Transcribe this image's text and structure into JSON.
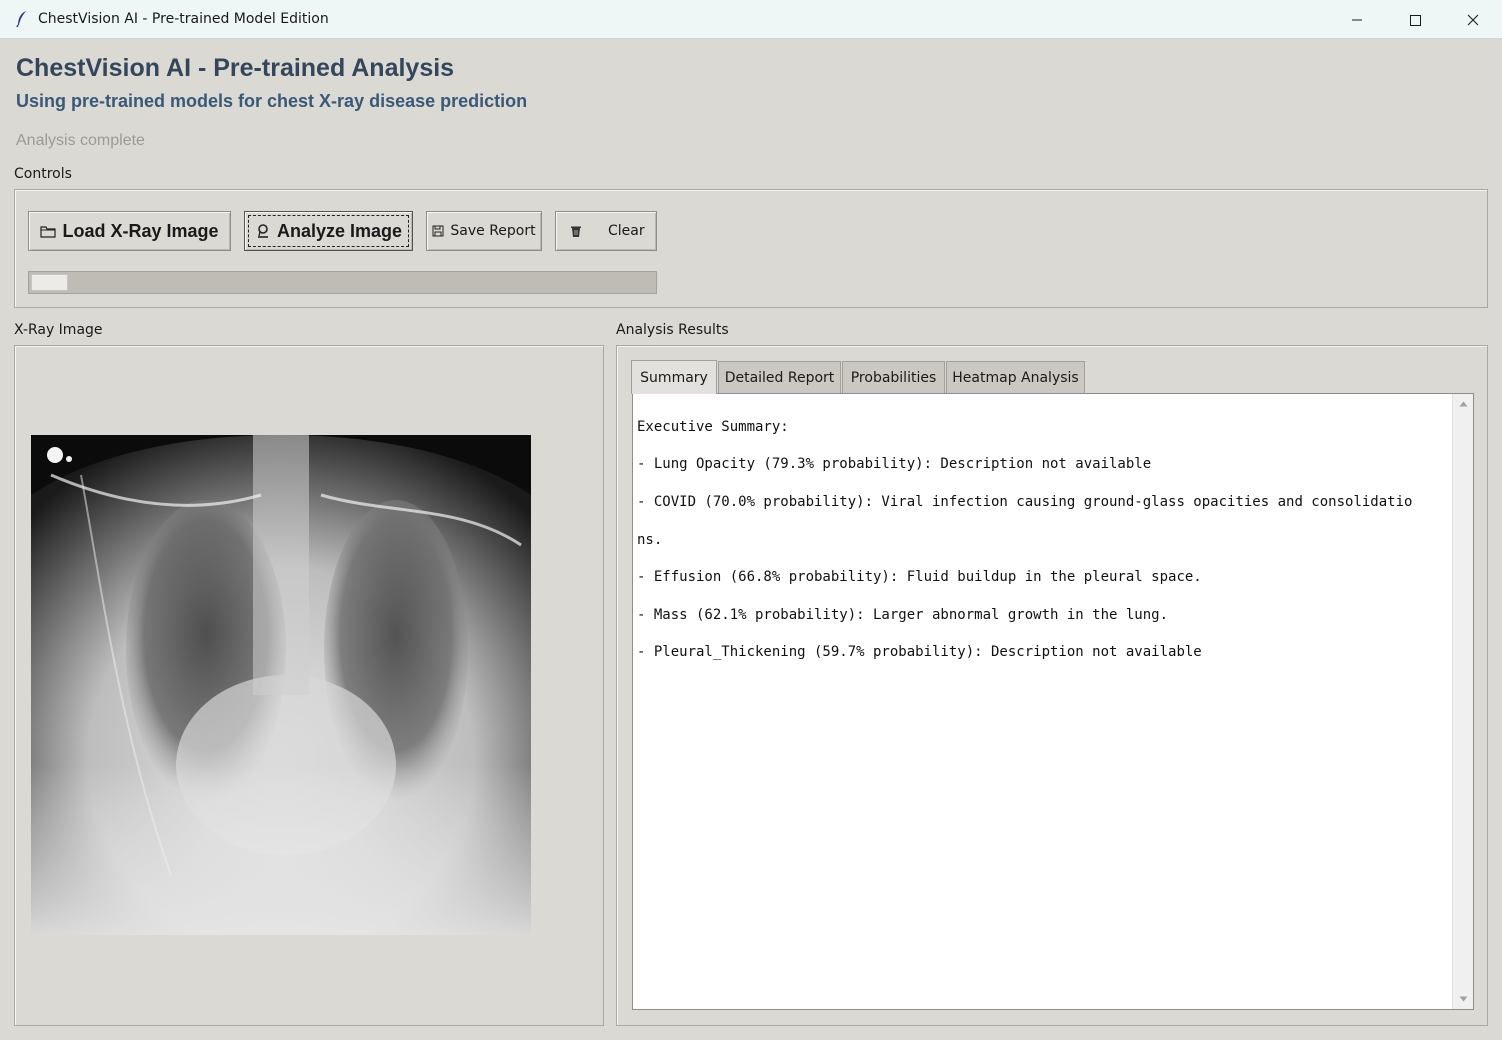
{
  "window": {
    "title": "ChestVision AI - Pre-trained Model Edition",
    "controls": {
      "minimize": "minimize-icon",
      "maximize": "maximize-icon",
      "close": "close-icon"
    }
  },
  "header": {
    "title": "ChestVision AI - Pre-trained Analysis",
    "subtitle": "Using pre-trained models for chest X-ray disease prediction",
    "status": "Analysis complete"
  },
  "controls": {
    "label": "Controls",
    "load_button": {
      "label": "Load X-Ray Image",
      "icon": "folder-icon"
    },
    "analyze_button": {
      "label": "Analyze Image",
      "icon": "magnifier-icon"
    },
    "save_button": {
      "label": "Save Report",
      "icon": "floppy-disk-icon"
    },
    "clear_button": {
      "label": "Clear",
      "icon": "trash-icon"
    },
    "progress_fraction": 0.06
  },
  "xray_panel": {
    "label": "X-Ray Image"
  },
  "results_panel": {
    "label": "Analysis Results",
    "tabs": [
      {
        "label": "Summary",
        "active": true
      },
      {
        "label": "Detailed Report",
        "active": false
      },
      {
        "label": "Probabilities",
        "active": false
      },
      {
        "label": "Heatmap Analysis",
        "active": false
      }
    ],
    "summary_lines": [
      "Executive Summary:",
      "- Lung Opacity (79.3% probability): Description not available",
      "- COVID (70.0% probability): Viral infection causing ground-glass opacities and consolidatio",
      "ns.",
      "- Effusion (66.8% probability): Fluid buildup in the pleural space.",
      "- Mass (62.1% probability): Larger abnormal growth in the lung.",
      "- Pleural_Thickening (59.7% probability): Description not available"
    ]
  },
  "colors": {
    "title": "#35465a",
    "subtitle": "#3a5878",
    "status": "#9a9a98",
    "window_bg": "#dbd9d4",
    "titlebar_bg": "#eef7f6"
  }
}
